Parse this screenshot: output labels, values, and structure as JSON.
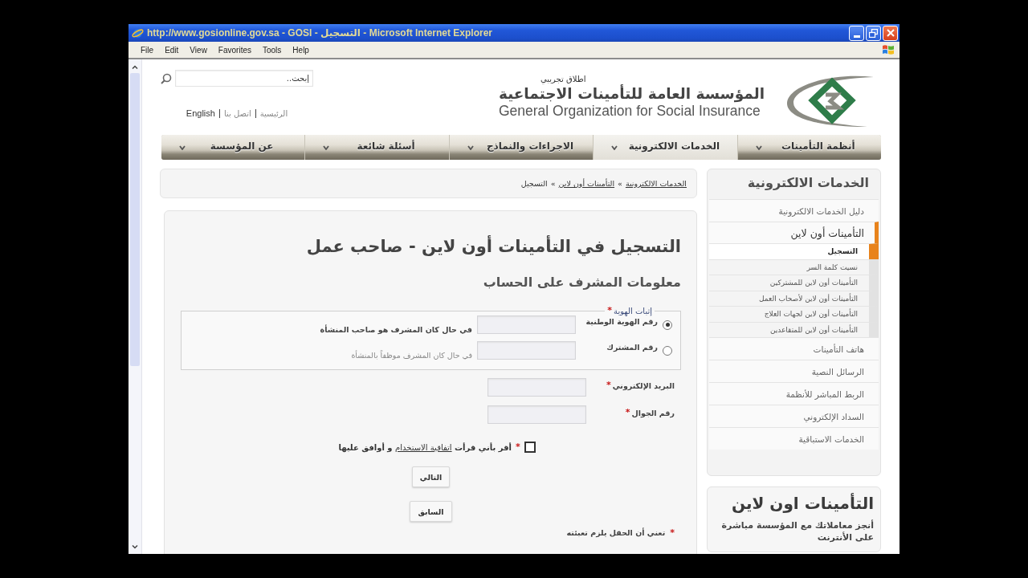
{
  "window": {
    "title": "http://www.gosionline.gov.sa - GOSI - التسجيل - Microsoft Internet Explorer"
  },
  "menu_bar": {
    "file": "File",
    "edit": "Edit",
    "view": "View",
    "favorites": "Favorites",
    "tools": "Tools",
    "help": "Help"
  },
  "header": {
    "search": {
      "placeholder": "إبحث.."
    },
    "links": [
      "الرئيسية",
      "اتصل بنا",
      "English"
    ],
    "logo": {
      "tagline": "اطلاق تجريبي",
      "name_ar": "المؤسسة العامة للتأمينات الاجتماعية",
      "name_en": "General Organization for Social Insurance"
    }
  },
  "nav": [
    {
      "label": "أنظمة التأمينات",
      "selected": false
    },
    {
      "label": "الخدمات الالكترونية",
      "selected": true
    },
    {
      "label": "الاجراءات والنماذج",
      "selected": false
    },
    {
      "label": "أسئلة شائعة",
      "selected": false
    },
    {
      "label": "عن المؤسسة",
      "selected": false
    }
  ],
  "breadcrumb": [
    {
      "label": "الخدمات الالكترونية",
      "kind": "link",
      "separator": "»"
    },
    {
      "label": "التأمينات أون لاين",
      "kind": "link",
      "separator": "»"
    },
    {
      "label": "التسجيل",
      "kind": "current"
    }
  ],
  "form": {
    "title": "التسجيل في التأمينات أون لاين - صاحب عمل",
    "subtitle": "معلومات المشرف على الحساب",
    "identity": {
      "legend": "إثبات الهوية",
      "required_mark": "*",
      "options": [
        {
          "label": "رقم الهوية الوطنية",
          "hint": "في حال كان المشرف هو صاحب المنشأة",
          "selected": true
        },
        {
          "label": "رقم المشترك",
          "hint": "في حال كان المشرف موظفاً بالمنشأة",
          "selected": false
        }
      ]
    },
    "fields": [
      {
        "label": "البريد الإلكتروني",
        "required_mark": "*"
      },
      {
        "label": "رقم الجوال",
        "required_mark": "*"
      }
    ],
    "agreement": {
      "checked": false,
      "required_mark": "*",
      "text_before": "أقر بأني قرأت",
      "link": "اتفاقية الاستخدام",
      "text_after": "و أوافق عليها"
    },
    "buttons": [
      "التالي",
      "السابق"
    ],
    "note": {
      "required_mark": "*",
      "text": "تعني أن الحقل يلزم تعبئته"
    }
  },
  "sidebar": {
    "title": "الخدمات الالكترونية",
    "items": [
      {
        "label": "دليل الخدمات الالكترونية",
        "expanded": false
      },
      {
        "label": "التأمينات أون لاين",
        "expanded": true,
        "children": [
          {
            "label": "التسجيل",
            "selected": true
          },
          {
            "label": "نسيت كلمة السر",
            "selected": false
          },
          {
            "label": "التأمينات أون لاين للمشتركين",
            "selected": false
          },
          {
            "label": "التأمينات أون لاين لأصحاب العمل",
            "selected": false
          },
          {
            "label": "التأمينات أون لاين لجهات العلاج",
            "selected": false
          },
          {
            "label": "التأمينات أون لاين للمتقاعدين",
            "selected": false
          }
        ]
      },
      {
        "label": "هاتف التأمينات",
        "expanded": false
      },
      {
        "label": "الرسائل النصية",
        "expanded": false
      },
      {
        "label": "الربط المباشر للأنظمة",
        "expanded": false
      },
      {
        "label": "السداد الإلكتروني",
        "expanded": false
      },
      {
        "label": "الخدمات الاستباقية",
        "expanded": false
      }
    ]
  },
  "promo": {
    "title": "التأمينات اون لاين",
    "text": "أنجز معاملاتك مع المؤسسة مباشرة على الأنترنت"
  }
}
